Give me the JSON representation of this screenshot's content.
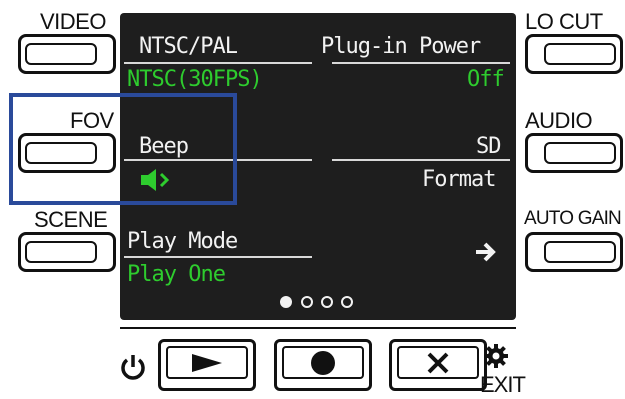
{
  "side_buttons": {
    "video": "VIDEO",
    "fov": "FOV",
    "scene": "SCENE",
    "lo_cut": "LO CUT",
    "audio": "AUDIO",
    "auto_gain": "AUTO GAIN"
  },
  "screen": {
    "left": {
      "ntsc_pal": {
        "label": "NTSC/PAL",
        "value": "NTSC(30FPS)"
      },
      "beep": {
        "label": "Beep",
        "value_icon": "speaker-on-icon"
      },
      "play_mode": {
        "label": "Play Mode",
        "value": "Play One"
      }
    },
    "right": {
      "plugin_power": {
        "label": "Plug-in Power",
        "value": "Off"
      },
      "sd_format": {
        "label": "SD",
        "label2": "Format"
      },
      "next_icon": "arrow-right-icon"
    },
    "page_indicator": {
      "current": 1,
      "total": 4
    }
  },
  "bottom": {
    "power_icon": "power-icon",
    "play_icon": "play-icon",
    "record_icon": "record-icon",
    "cancel_icon": "x-icon",
    "settings_icon": "gear-icon",
    "exit_label": "EXIT"
  },
  "colors": {
    "screen_bg": "#1e1e1e",
    "screen_text": "#f2f2f2",
    "screen_value": "#2ecc2e",
    "highlight": "#2a4a9a"
  }
}
